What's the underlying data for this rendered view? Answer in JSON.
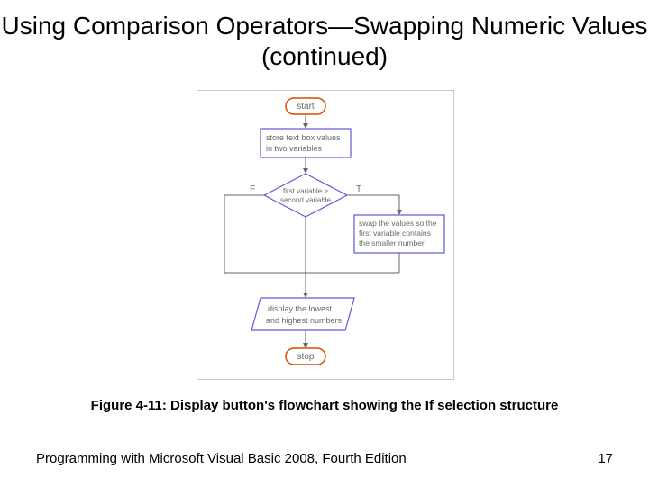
{
  "title": "Using Comparison Operators—Swapping Numeric Values (continued)",
  "caption": "Figure 4-11: Display button's flowchart showing the If selection structure",
  "footer_left": "Programming with Microsoft Visual Basic 2008, Fourth Edition",
  "footer_right": "17",
  "flowchart": {
    "start": "start",
    "store_line1": "store text box values",
    "store_line2": "in two variables",
    "decision_line1": "first variable >",
    "decision_line2": "second variable",
    "false_label": "F",
    "true_label": "T",
    "swap_line1": "swap the values so the",
    "swap_line2": "first variable contains",
    "swap_line3": "the smaller number",
    "display_line1": "display the lowest",
    "display_line2": "and highest numbers",
    "stop": "stop"
  },
  "colors": {
    "terminator_stroke": "#d94a00",
    "process_stroke": "#5a5ad6",
    "decision_stroke": "#5a5ad6",
    "io_stroke": "#5a5ad6",
    "connector": "#666666",
    "text": "#6a6a6a"
  }
}
